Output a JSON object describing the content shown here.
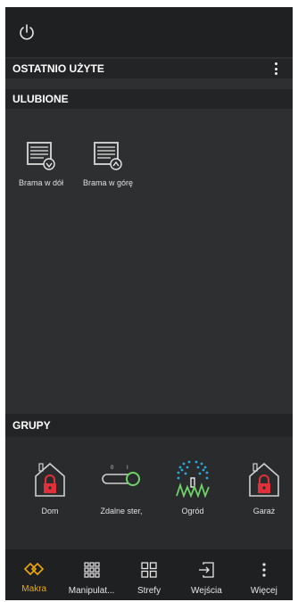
{
  "colors": {
    "accent": "#f2a900",
    "danger": "#e0303a",
    "plant": "#6fd36a",
    "water": "#2aa8e0"
  },
  "header": {
    "icon": "power-icon"
  },
  "sections": {
    "recent": "OSTATNIO UŻYTE",
    "favorites": "ULUBIONE",
    "groups": "GRUPY"
  },
  "favorites": [
    {
      "label": "Brama w dół",
      "icon": "gate-down-icon"
    },
    {
      "label": "Brama w górę",
      "icon": "gate-up-icon"
    }
  ],
  "groups": [
    {
      "label": "Dom",
      "icon": "house-lock-icon"
    },
    {
      "label": "Zdalne ster,",
      "icon": "remote-switch-icon",
      "marks": [
        "0",
        "I"
      ]
    },
    {
      "label": "Ogród",
      "icon": "sprinkler-icon"
    },
    {
      "label": "Garaż",
      "icon": "garage-lock-icon"
    }
  ],
  "bottom_nav": [
    {
      "label": "Makra",
      "icon": "macros-icon",
      "active": true
    },
    {
      "label": "Manipulat...",
      "icon": "grid-9-icon"
    },
    {
      "label": "Strefy",
      "icon": "grid-4-icon"
    },
    {
      "label": "Wejścia",
      "icon": "login-icon"
    },
    {
      "label": "Więcej",
      "icon": "more-icon"
    }
  ]
}
